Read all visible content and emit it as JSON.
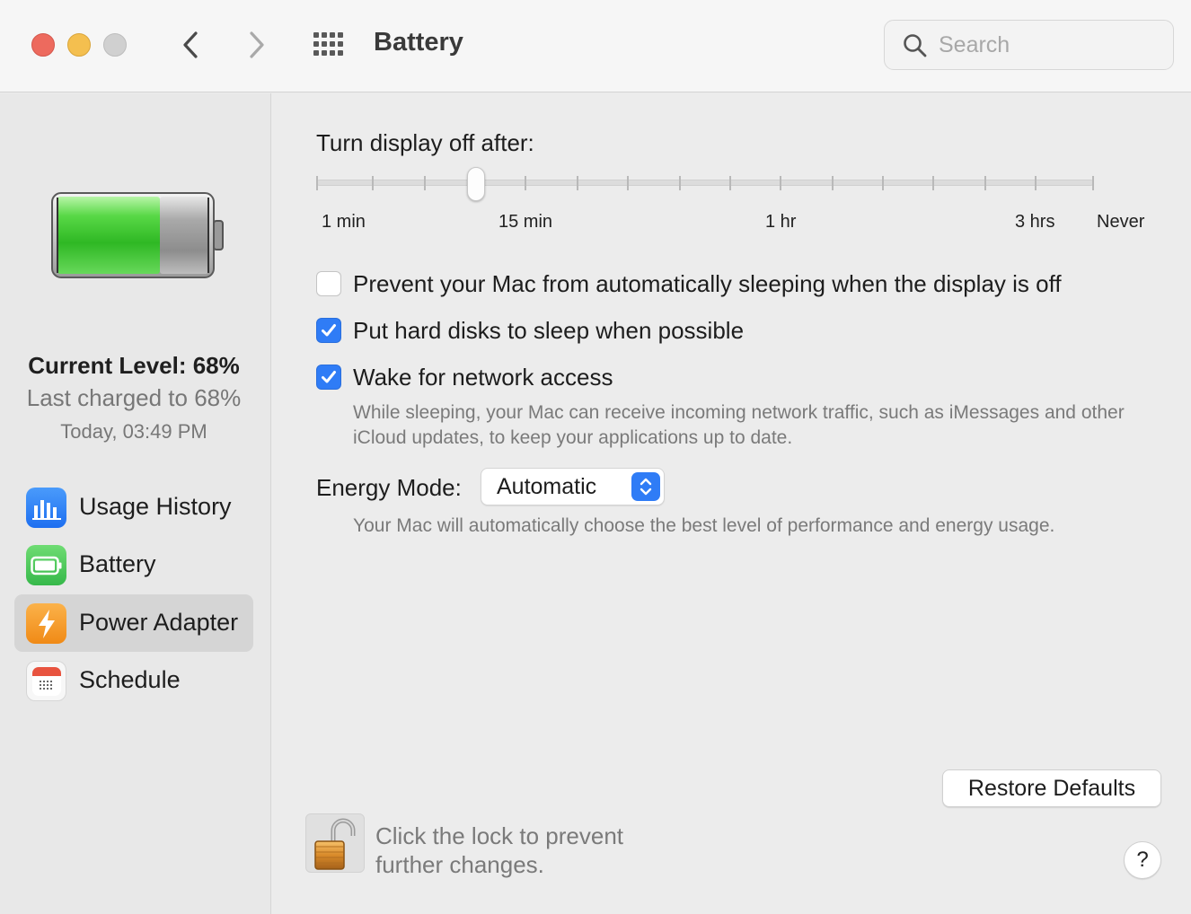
{
  "window": {
    "title": "Battery",
    "search_placeholder": "Search"
  },
  "toolbar": {
    "back_icon": "chevron-left-icon",
    "forward_icon": "chevron-right-icon",
    "show_all_icon": "grid-icon"
  },
  "sidebar": {
    "current_level": "Current Level: 68%",
    "battery_level_fraction": 0.68,
    "last_charged": "Last charged to 68%",
    "charge_time": "Today, 03:49 PM",
    "items": [
      {
        "label": "Usage History",
        "icon": "bar-chart-icon",
        "color": "#2f7cf6",
        "selected": false
      },
      {
        "label": "Battery",
        "icon": "battery-icon",
        "color": "#4cc765",
        "selected": false
      },
      {
        "label": "Power Adapter",
        "icon": "lightning-bolt-icon",
        "color": "#f39a24",
        "selected": true
      },
      {
        "label": "Schedule",
        "icon": "calendar-icon",
        "color": "#e8533f",
        "selected": false
      }
    ]
  },
  "main": {
    "display_off_label": "Turn display off after:",
    "slider": {
      "tick_labels": [
        "1 min",
        "15 min",
        "1 hr",
        "3 hrs",
        "Never"
      ],
      "selected_label": "10 min"
    },
    "checkboxes": [
      {
        "label": "Prevent your Mac from automatically sleeping when the display is off",
        "checked": false
      },
      {
        "label": "Put hard disks to sleep when possible",
        "checked": true
      },
      {
        "label": "Wake for network access",
        "checked": true
      }
    ],
    "wake_help": "While sleeping, your Mac can receive incoming network traffic, such as iMessages and other iCloud updates, to keep your applications up to date.",
    "energy_mode_label": "Energy Mode:",
    "energy_mode_value": "Automatic",
    "energy_mode_help": "Your Mac will automatically choose the best level of performance and energy usage.",
    "restore_defaults": "Restore Defaults",
    "lock_text": "Click the lock to prevent further changes.",
    "help_label": "?"
  },
  "colors": {
    "accent": "#2f7cf6",
    "close": "#ed6a5e",
    "minimize": "#f4bf4f",
    "zoom_disabled": "#d0d0d0"
  }
}
